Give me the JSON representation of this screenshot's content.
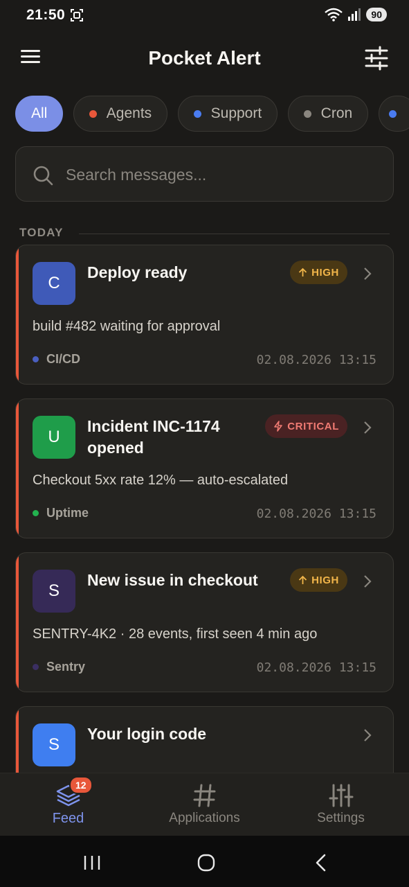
{
  "status": {
    "time": "21:50",
    "battery": "90"
  },
  "header": {
    "title": "Pocket Alert"
  },
  "chips": [
    {
      "label": "All",
      "active": true,
      "dot": ""
    },
    {
      "label": "Agents",
      "active": false,
      "dot": "#e8573a"
    },
    {
      "label": "Support",
      "active": false,
      "dot": "#4a7cf0"
    },
    {
      "label": "Cron",
      "active": false,
      "dot": "#8a867f"
    }
  ],
  "search": {
    "placeholder": "Search messages..."
  },
  "section": {
    "label": "TODAY"
  },
  "cards": [
    {
      "avatar": "C",
      "avatar_color": "#3f5ab8",
      "title_line1": "Deploy ready",
      "title_line2": "",
      "badge": "HIGH",
      "badge_type": "high",
      "body": "build #482 waiting for approval",
      "source": "CI/CD",
      "source_color": "#4a5fc0",
      "time": "02.08.2026 13:15"
    },
    {
      "avatar": "U",
      "avatar_color": "#1f9d4a",
      "title_line1": "Incident INC-1174",
      "title_line2": "opened",
      "badge": "CRITICAL",
      "badge_type": "critical",
      "body": "Checkout 5xx rate 12% — auto-escalated",
      "source": "Uptime",
      "source_color": "#23b24f",
      "time": "02.08.2026 13:15"
    },
    {
      "avatar": "S",
      "avatar_color": "#362a57",
      "title_line1": "New issue in checkout",
      "title_line2": "",
      "badge": "HIGH",
      "badge_type": "high",
      "body": "SENTRY-4K2 · 28 events, first seen 4 min ago",
      "source": "Sentry",
      "source_color": "#3b2f62",
      "time": "02.08.2026 13:15"
    },
    {
      "avatar": "S",
      "avatar_color": "#3f7ef0",
      "title_line1": "Your login code",
      "title_line2": "",
      "badge": "",
      "badge_type": "",
      "body": "",
      "source": "",
      "source_color": "",
      "time": ""
    }
  ],
  "nav": {
    "feed": "Feed",
    "feed_badge": "12",
    "applications": "Applications",
    "settings": "Settings"
  },
  "colors": {
    "accent": "#7b8fe6",
    "alert_bar": "#e8573a",
    "background": "#1b1a18"
  }
}
